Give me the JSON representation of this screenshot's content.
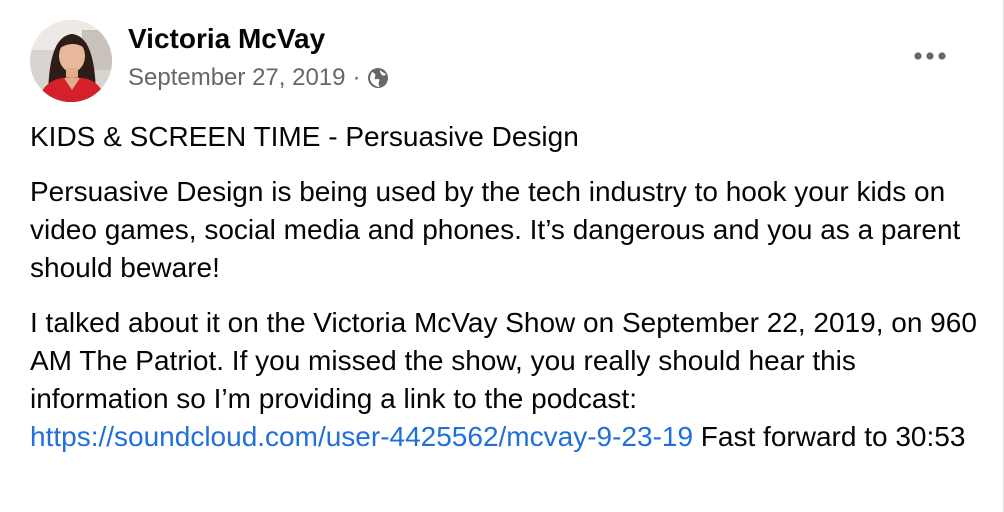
{
  "post": {
    "author_name": "Victoria McVay",
    "date": "September 27, 2019",
    "separator": "·",
    "privacy_icon": "globe-icon",
    "more_icon": "more-options-icon",
    "title": "KIDS & SCREEN TIME - Persuasive Design",
    "paragraph1": "Persuasive Design is being used by the tech industry to hook your kids on video games, social media and phones. It’s dangerous and you as a parent should beware!",
    "paragraph2_text": "I talked about it on the Victoria McVay Show on September 22, 2019, on 960 AM The Patriot. If you missed the show, you really should hear this information so I’m providing a link to the podcast: ",
    "link_text": "https://soundcloud.com/user-4425562/mcvay-9-23-19",
    "paragraph2_after": " Fast forward to 30:53"
  },
  "colors": {
    "text": "#050505",
    "secondary_text": "#65676b",
    "link": "#216fdb",
    "background": "#ffffff"
  }
}
